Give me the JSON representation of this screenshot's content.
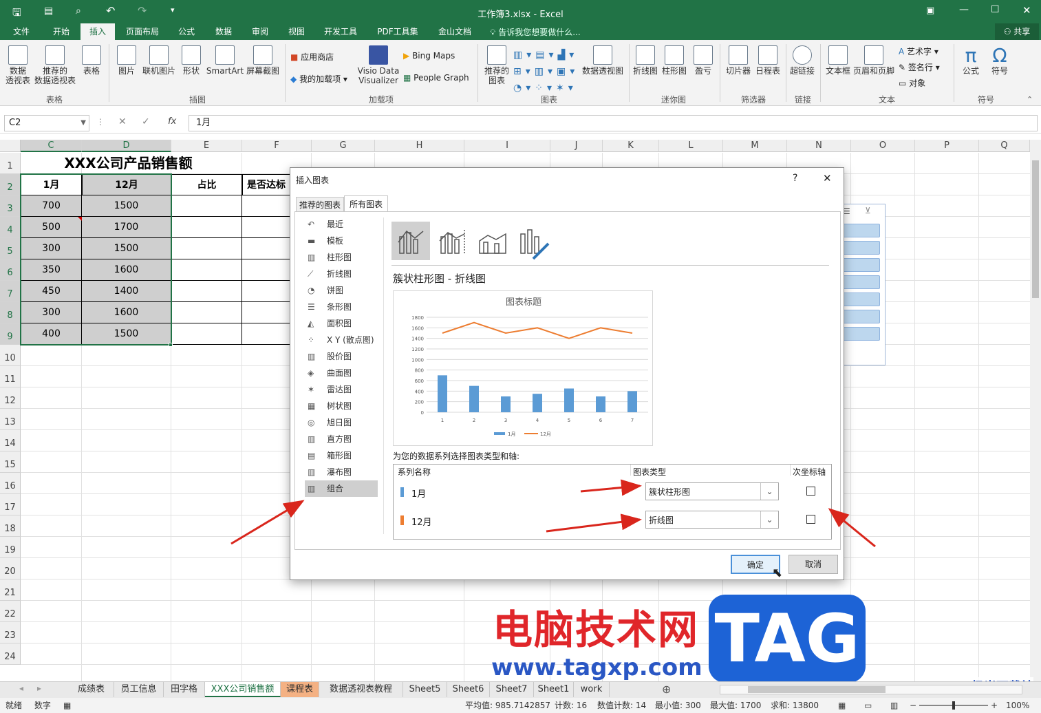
{
  "window": {
    "title": "工作簿3.xlsx - Excel",
    "share": "共享",
    "tell_me": "告诉我您想要做什么..."
  },
  "ribbon_tabs": [
    "文件",
    "开始",
    "插入",
    "页面布局",
    "公式",
    "数据",
    "审阅",
    "视图",
    "开发工具",
    "PDF工具集",
    "金山文档"
  ],
  "ribbon": {
    "pivot": "数据\n透视表",
    "rec_pivot": "推荐的\n数据透视表",
    "table": "表格",
    "group_table": "表格",
    "picture": "图片",
    "online_picture": "联机图片",
    "shapes": "形状",
    "smartart": "SmartArt",
    "screenshot": "屏幕截图",
    "group_illus": "插图",
    "store": "应用商店",
    "my_addins": "我的加载项",
    "visio": "Visio Data\nVisualizer",
    "bing": "Bing Maps",
    "people": "People Graph",
    "group_addins": "加载项",
    "rec_charts": "推荐的\n图表",
    "pivot_chart": "数据透视图",
    "group_charts": "图表",
    "line_spark": "折线图",
    "col_spark": "柱形图",
    "winloss": "盈亏",
    "group_spark": "迷你图",
    "slicer": "切片器",
    "timeline": "日程表",
    "group_filter": "筛选器",
    "hyperlink": "超链接",
    "group_link": "链接",
    "textbox": "文本框",
    "header_footer": "页眉和页脚",
    "wordart": "艺术字",
    "signature": "签名行",
    "object": "对象",
    "group_text": "文本",
    "equation": "公式",
    "symbol": "符号",
    "group_symbol": "符号"
  },
  "formula_bar": {
    "name_box": "C2",
    "fx": "fx",
    "value": "1月"
  },
  "columns": [
    "C",
    "D",
    "E",
    "F",
    "G",
    "H",
    "I",
    "J",
    "K",
    "L",
    "M",
    "N",
    "O",
    "P",
    "Q"
  ],
  "rows": [
    "1",
    "2",
    "3",
    "4",
    "5",
    "6",
    "7",
    "8",
    "9",
    "10",
    "11",
    "12",
    "13",
    "14",
    "15",
    "16",
    "17",
    "18",
    "19",
    "20",
    "21",
    "22",
    "23",
    "24"
  ],
  "sheet": {
    "title": "XXX公司产品销售额",
    "headers": [
      "1月",
      "12月",
      "占比",
      "是否达标"
    ],
    "data": [
      [
        "700",
        "1500"
      ],
      [
        "500",
        "1700"
      ],
      [
        "300",
        "1500"
      ],
      [
        "350",
        "1600"
      ],
      [
        "450",
        "1400"
      ],
      [
        "300",
        "1600"
      ],
      [
        "400",
        "1500"
      ]
    ]
  },
  "dialog": {
    "title": "插入图表",
    "help": "?",
    "close": "✕",
    "tabs": [
      "推荐的图表",
      "所有图表"
    ],
    "chart_types": [
      "最近",
      "模板",
      "柱形图",
      "折线图",
      "饼图",
      "条形图",
      "面积图",
      "X Y (散点图)",
      "股价图",
      "曲面图",
      "雷达图",
      "树状图",
      "旭日图",
      "直方图",
      "箱形图",
      "瀑布图",
      "组合"
    ],
    "selected_type": "组合",
    "subtype_title": "簇状柱形图 - 折线图",
    "series_prompt": "为您的数据系列选择图表类型和轴:",
    "series_headers": [
      "系列名称",
      "图表类型",
      "次坐标轴"
    ],
    "series": [
      {
        "name": "1月",
        "type": "簇状柱形图",
        "color": "#5b9bd5"
      },
      {
        "name": "12月",
        "type": "折线图",
        "color": "#ed7d31"
      }
    ],
    "ok": "确定",
    "cancel": "取消"
  },
  "chart_data": {
    "type": "bar",
    "title": "图表标题",
    "categories": [
      "1",
      "2",
      "3",
      "4",
      "5",
      "6",
      "7"
    ],
    "ylim": [
      0,
      1800
    ],
    "yticks": [
      "0",
      "200",
      "400",
      "600",
      "800",
      "1000",
      "1200",
      "1400",
      "1600",
      "1800"
    ],
    "series": [
      {
        "name": "1月",
        "type": "bar",
        "color": "#5b9bd5",
        "values": [
          700,
          500,
          300,
          350,
          450,
          300,
          400
        ]
      },
      {
        "name": "12月",
        "type": "line",
        "color": "#ed7d31",
        "values": [
          1500,
          1700,
          1500,
          1600,
          1400,
          1600,
          1500
        ]
      }
    ],
    "legend": "bottom"
  },
  "sheet_tabs": [
    "成绩表",
    "员工信息",
    "田字格",
    "XXX公司销售额",
    "课程表",
    "数据透视表教程",
    "Sheet5",
    "Sheet6",
    "Sheet7",
    "Sheet1",
    "work"
  ],
  "active_sheet": "XXX公司销售额",
  "status": {
    "ready": "就绪",
    "mode": "数字",
    "average": "平均值: 985.7142857",
    "count": "计数: 16",
    "num_count": "数值计数: 14",
    "min": "最小值: 300",
    "max": "最大值: 1700",
    "sum": "求和: 13800",
    "zoom": "100%"
  },
  "watermark": {
    "text": "电脑技术网",
    "tag": "TAG",
    "url": "www.tagxp.com",
    "corner": "极光下载站"
  }
}
